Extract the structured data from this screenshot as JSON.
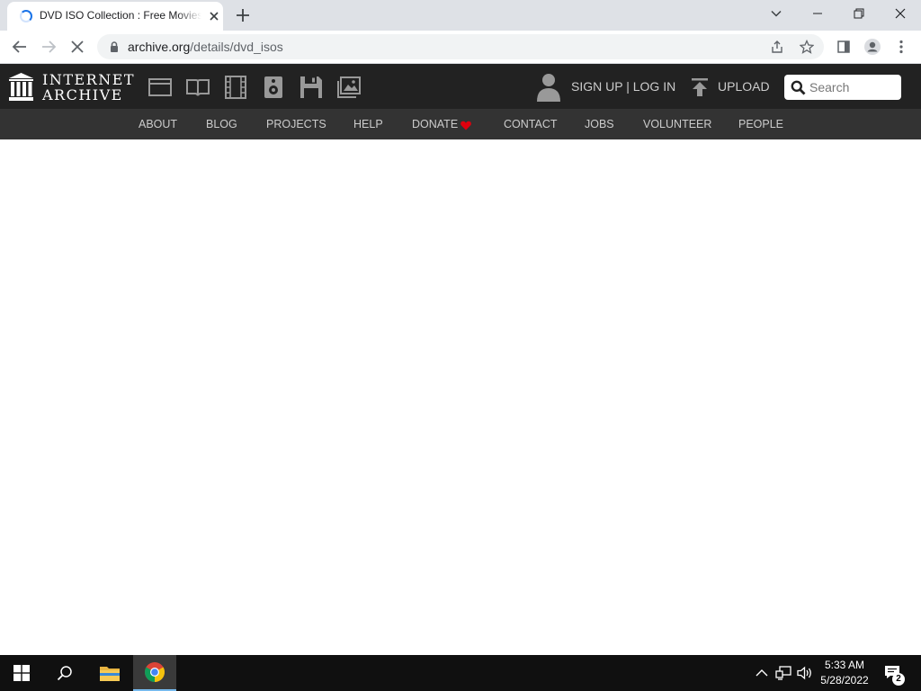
{
  "browser": {
    "tab": {
      "title": "DVD ISO Collection : Free Movies : Free Download, Borrow and Streaming : Internet Archive"
    },
    "url": {
      "host": "archive.org",
      "path": "/details/dvd_isos"
    }
  },
  "ia": {
    "logo": {
      "line1": "INTERNET",
      "line2": "ARCHIVE"
    },
    "media_icons": [
      "web-icon",
      "texts-icon",
      "video-icon",
      "audio-icon",
      "software-icon",
      "images-icon"
    ],
    "account": {
      "signup": "SIGN UP",
      "separator": "|",
      "login": "LOG IN"
    },
    "upload": "UPLOAD",
    "search": {
      "placeholder": "Search"
    },
    "nav": {
      "about": "ABOUT",
      "blog": "BLOG",
      "projects": "PROJECTS",
      "help": "HELP",
      "donate": "DONATE",
      "contact": "CONTACT",
      "jobs": "JOBS",
      "volunteer": "VOLUNTEER",
      "people": "PEOPLE"
    }
  },
  "taskbar": {
    "time": "5:33 AM",
    "date": "5/28/2022",
    "notifications": "2"
  },
  "colors": {
    "ia_header": "#222222",
    "ia_subnav": "#333333",
    "donate_heart": "#e0000d",
    "chrome_tabstrip": "#dee1e6",
    "taskbar": "#101010"
  }
}
